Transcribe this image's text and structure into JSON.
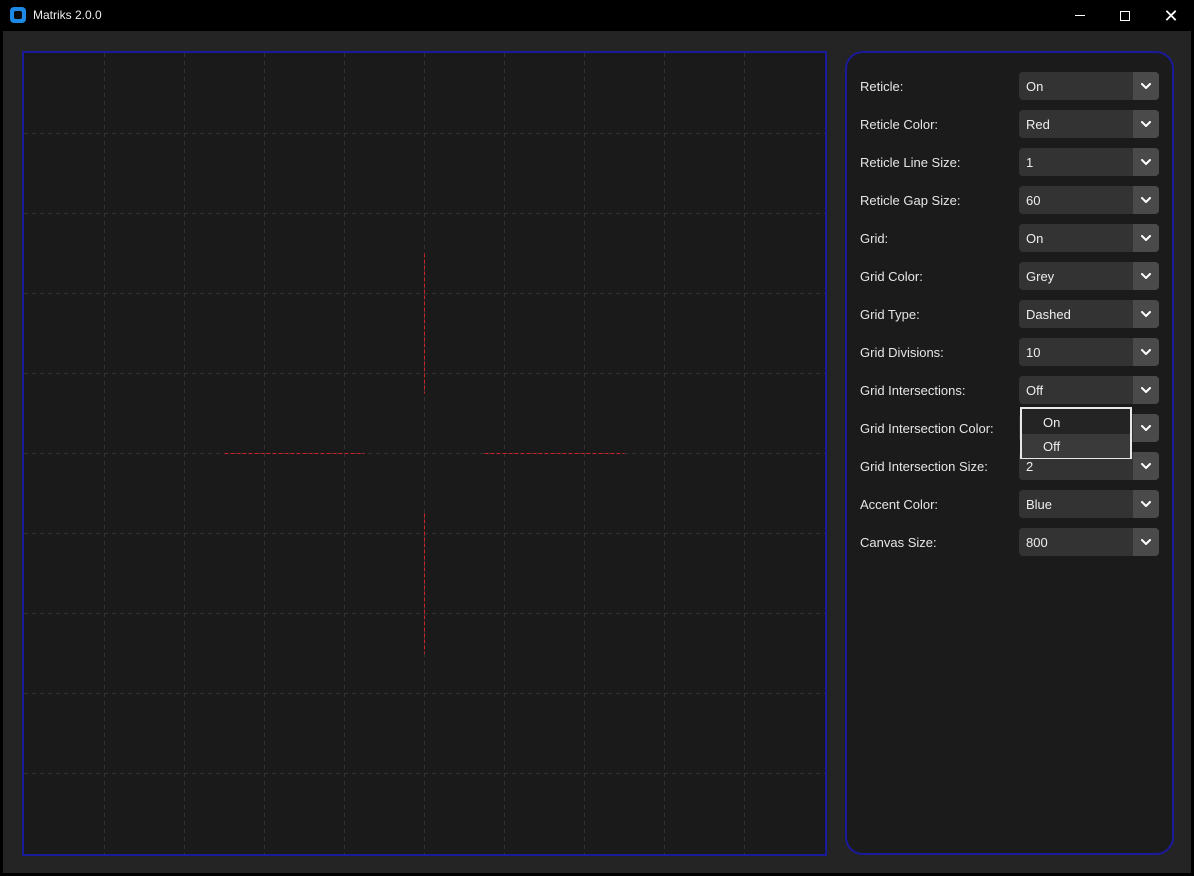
{
  "window": {
    "title": "Matriks 2.0.0",
    "icons": {
      "app": "app-icon",
      "minimize": "minimize-icon",
      "maximize": "maximize-icon",
      "close": "close-icon",
      "close_glyph": "✕"
    }
  },
  "colors": {
    "accent_border": "#1a1a9a",
    "reticle": "#c8232a",
    "grid": "#333333",
    "canvas_bg": "#1a1a1a"
  },
  "canvas": {
    "grid_divisions": 10,
    "reticle_gap": 60
  },
  "settings": [
    {
      "label": "Reticle:",
      "value": "On"
    },
    {
      "label": "Reticle Color:",
      "value": "Red"
    },
    {
      "label": "Reticle Line Size:",
      "value": "1"
    },
    {
      "label": "Reticle Gap Size:",
      "value": "60"
    },
    {
      "label": "Grid:",
      "value": "On"
    },
    {
      "label": "Grid Color:",
      "value": "Grey"
    },
    {
      "label": "Grid Type:",
      "value": "Dashed"
    },
    {
      "label": "Grid Divisions:",
      "value": "10"
    },
    {
      "label": "Grid Intersections:",
      "value": "Off"
    },
    {
      "label": "Grid Intersection Color:",
      "value": ""
    },
    {
      "label": "Grid Intersection Size:",
      "value": "2"
    },
    {
      "label": "Accent Color:",
      "value": "Blue"
    },
    {
      "label": "Canvas Size:",
      "value": "800"
    }
  ],
  "open_menu": {
    "options": [
      "On",
      "Off"
    ],
    "highlighted": "Off"
  }
}
